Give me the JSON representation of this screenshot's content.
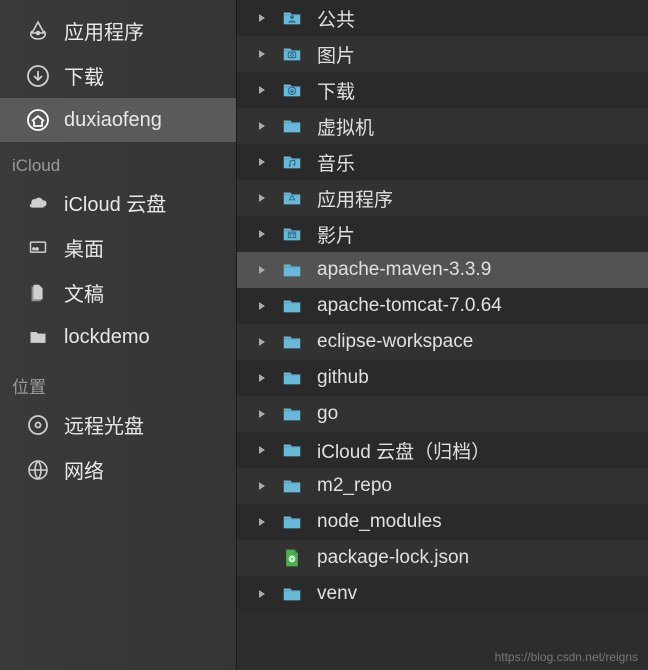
{
  "sidebar": {
    "favorites": [
      {
        "icon": "applications-icon",
        "label": "应用程序"
      },
      {
        "icon": "download-icon",
        "label": "下载"
      },
      {
        "icon": "home-icon",
        "label": "duxiaofeng",
        "selected": true
      }
    ],
    "icloud_header": "iCloud",
    "icloud": [
      {
        "icon": "cloud-icon",
        "label": "iCloud 云盘"
      },
      {
        "icon": "desktop-icon",
        "label": "桌面"
      },
      {
        "icon": "documents-icon",
        "label": "文稿"
      },
      {
        "icon": "folder-icon",
        "label": "lockdemo"
      }
    ],
    "locations_header": "位置",
    "locations": [
      {
        "icon": "disc-icon",
        "label": "远程光盘"
      },
      {
        "icon": "globe-icon",
        "label": "网络"
      }
    ]
  },
  "main": {
    "items": [
      {
        "icon": "folder-public",
        "label": "公共",
        "type": "folder"
      },
      {
        "icon": "folder-pictures",
        "label": "图片",
        "type": "folder"
      },
      {
        "icon": "folder-downloads",
        "label": "下载",
        "type": "folder"
      },
      {
        "icon": "folder",
        "label": "虚拟机",
        "type": "folder"
      },
      {
        "icon": "folder-music",
        "label": "音乐",
        "type": "folder"
      },
      {
        "icon": "folder-applications",
        "label": "应用程序",
        "type": "folder"
      },
      {
        "icon": "folder-movies",
        "label": "影片",
        "type": "folder"
      },
      {
        "icon": "folder",
        "label": "apache-maven-3.3.9",
        "type": "folder",
        "selected": true
      },
      {
        "icon": "folder",
        "label": "apache-tomcat-7.0.64",
        "type": "folder"
      },
      {
        "icon": "folder",
        "label": "eclipse-workspace",
        "type": "folder"
      },
      {
        "icon": "folder",
        "label": "github",
        "type": "folder"
      },
      {
        "icon": "folder",
        "label": "go",
        "type": "folder"
      },
      {
        "icon": "folder",
        "label": "iCloud 云盘（归档）",
        "type": "folder"
      },
      {
        "icon": "folder",
        "label": "m2_repo",
        "type": "folder"
      },
      {
        "icon": "folder",
        "label": "node_modules",
        "type": "folder"
      },
      {
        "icon": "json-file",
        "label": "package-lock.json",
        "type": "file"
      },
      {
        "icon": "folder",
        "label": "venv",
        "type": "folder"
      }
    ]
  },
  "watermark": "https://blog.csdn.net/reigns"
}
